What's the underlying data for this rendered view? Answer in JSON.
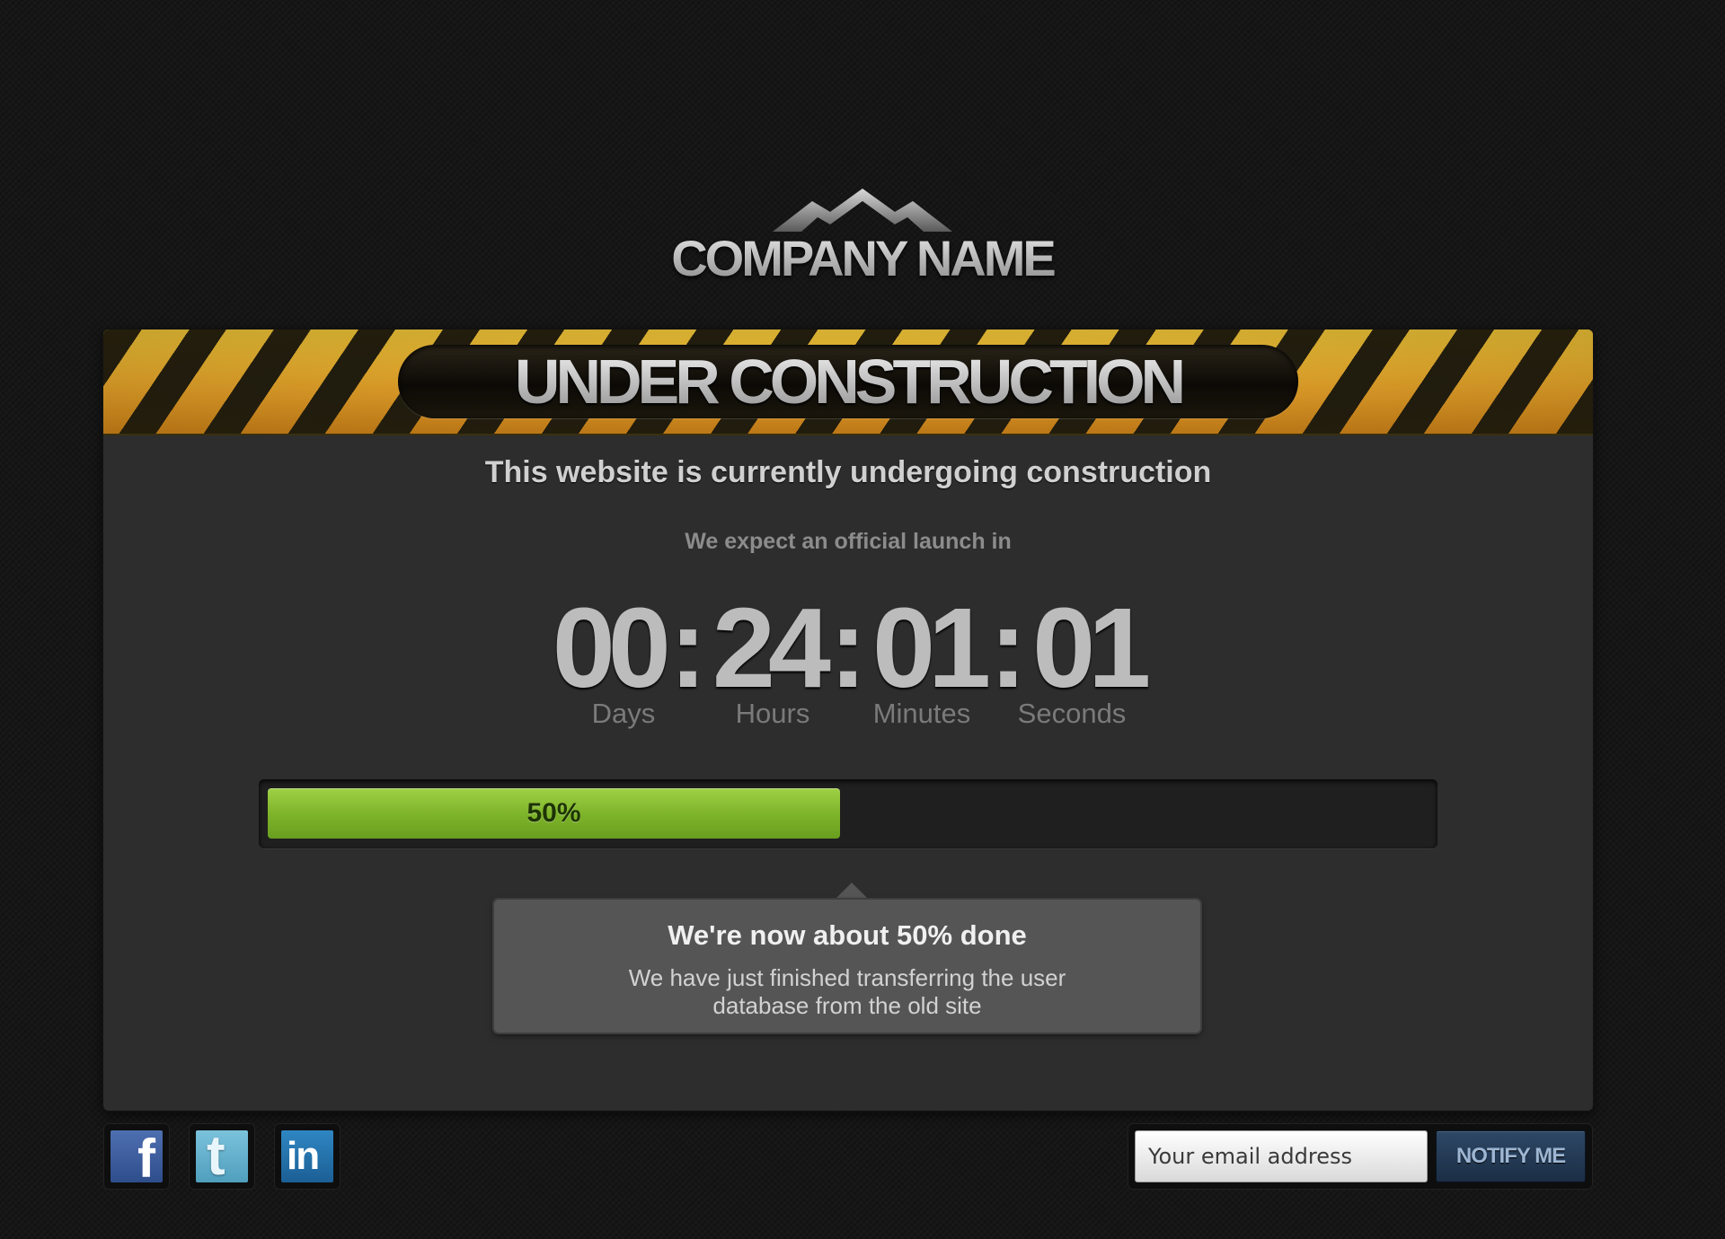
{
  "logo": {
    "name": "COMPANY NAME",
    "icon": "mountain-peaks-icon"
  },
  "banner": {
    "title": "UNDER CONSTRUCTION"
  },
  "main": {
    "headline": "This website is currently undergoing construction",
    "subline": "We expect an official launch in"
  },
  "countdown": {
    "days": "00",
    "hours": "24",
    "minutes": "01",
    "seconds": "01",
    "separator": ":",
    "labels": {
      "days": "Days",
      "hours": "Hours",
      "minutes": "Minutes",
      "seconds": "Seconds"
    }
  },
  "progress": {
    "percent": 50,
    "label": "50%",
    "color": "#7fb52b"
  },
  "status": {
    "title": "We're now about 50% done",
    "text": "We have just finished transferring the user database from the old site"
  },
  "social": [
    {
      "name": "facebook",
      "icon": "facebook-icon",
      "glyph": "f"
    },
    {
      "name": "twitter",
      "icon": "twitter-icon",
      "glyph": "t"
    },
    {
      "name": "linkedin",
      "icon": "linkedin-icon",
      "glyph": "in"
    }
  ],
  "notify": {
    "placeholder": "Your email address",
    "value": "",
    "button_label": "NOTIFY ME"
  },
  "colors": {
    "background": "#161616",
    "panel": "#2d2d2d",
    "stripe_yellow": "#f2c230",
    "stripe_dark": "#1c1a10",
    "progress_green": "#7fb52b",
    "notify_button": "#1b2e45"
  }
}
